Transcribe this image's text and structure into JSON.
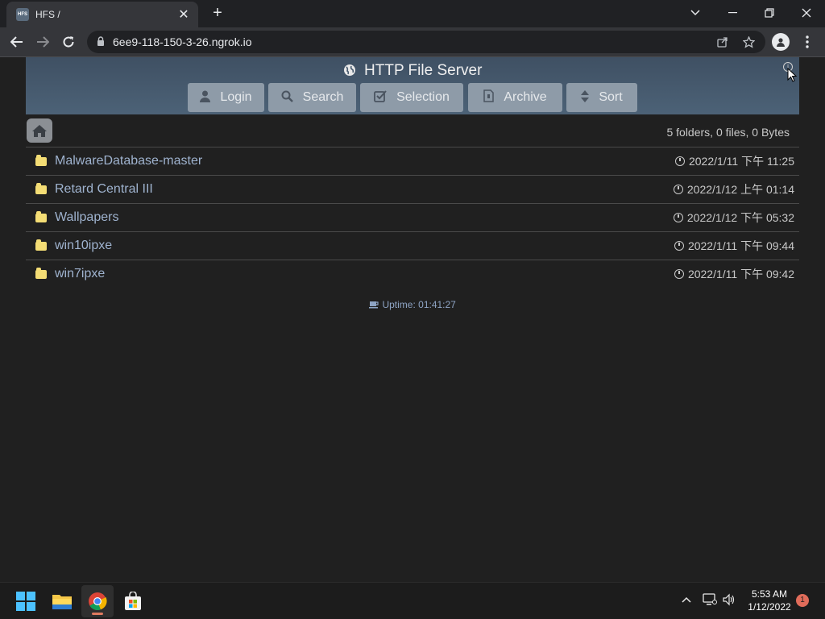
{
  "browser": {
    "tab_title": "HFS /",
    "favicon_text": "HFS",
    "url": "6ee9-118-150-3-26.ngrok.io"
  },
  "hfs": {
    "title": "HTTP File Server",
    "buttons": [
      {
        "label": "Login",
        "icon": "user-icon"
      },
      {
        "label": "Search",
        "icon": "search-icon"
      },
      {
        "label": "Selection",
        "icon": "checkbox-icon"
      },
      {
        "label": "Archive",
        "icon": "archive-icon"
      },
      {
        "label": "Sort",
        "icon": "sort-icon"
      }
    ],
    "stats": "5 folders, 0 files, 0 Bytes",
    "items": [
      {
        "name": "MalwareDatabase-master",
        "date": "2022/1/11 下午 11:25"
      },
      {
        "name": "Retard Central III",
        "date": "2022/1/12 上午 01:14"
      },
      {
        "name": "Wallpapers",
        "date": "2022/1/12 下午 05:32"
      },
      {
        "name": "win10ipxe",
        "date": "2022/1/11 下午 09:44"
      },
      {
        "name": "win7ipxe",
        "date": "2022/1/11 下午 09:42"
      }
    ],
    "uptime": "Uptime: 01:41:27"
  },
  "taskbar": {
    "time": "5:53 AM",
    "date": "1/12/2022",
    "notification_count": "1"
  },
  "colors": {
    "header_bg": "#46596d",
    "button_bg": "#8e9ba8",
    "folder": "#f4dd75",
    "link": "#9fb3cf"
  }
}
